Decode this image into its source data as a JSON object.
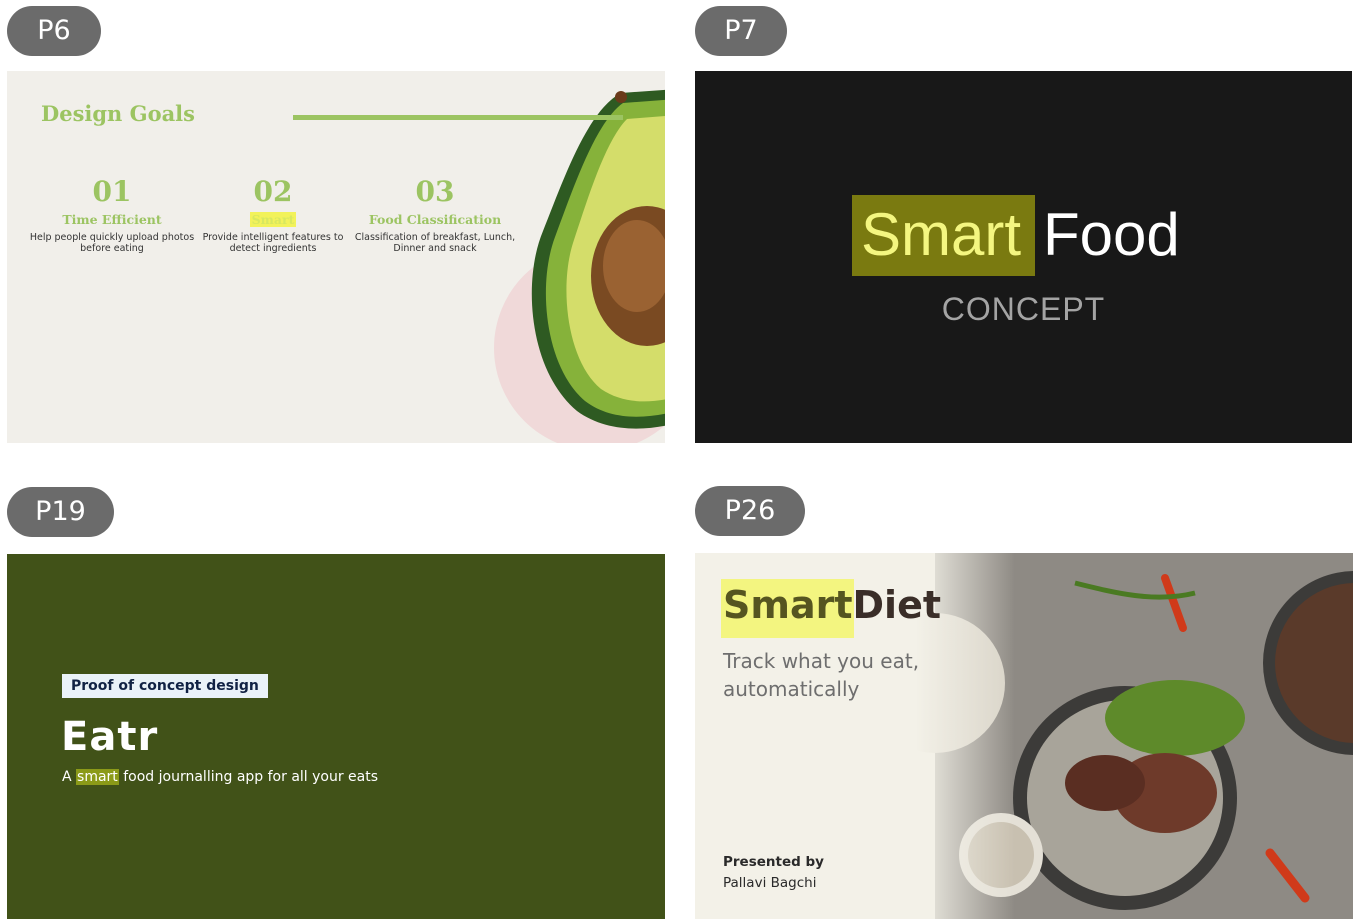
{
  "slides": [
    {
      "label": "P6"
    },
    {
      "label": "P7"
    },
    {
      "label": "P19"
    },
    {
      "label": "P26"
    }
  ],
  "p6": {
    "title": "Design Goals",
    "goals": [
      {
        "num": "01",
        "name": "Time Efficient",
        "line1": "Help people quickly upload photos",
        "line2": "before eating"
      },
      {
        "num": "02",
        "name": "Smart",
        "line1": "Provide intelligent features to",
        "line2": "detect ingredients"
      },
      {
        "num": "03",
        "name": "Food Classification",
        "line1": "Classification of breakfast, Lunch,",
        "line2": "Dinner and snack"
      }
    ]
  },
  "p7": {
    "word1": "Smart",
    "word2": "Food",
    "subtitle": "CONCEPT"
  },
  "p19": {
    "tag": "Proof of concept design",
    "app_name": "Eatr",
    "sub_pre": "A ",
    "sub_hl": "smart",
    "sub_post": " food journalling app for all your eats"
  },
  "p26": {
    "title_part1": "Smart",
    "title_part2": "Diet",
    "tagline": "Track what you eat, automatically",
    "presented_by": "Presented by",
    "author": "Pallavi Bagchi"
  },
  "colors": {
    "badge": "#6b6b6b",
    "green_accent": "#9cc462",
    "highlight_yellow": "#f3f580",
    "p19_bg": "#415218",
    "p7_bg": "#181818"
  }
}
